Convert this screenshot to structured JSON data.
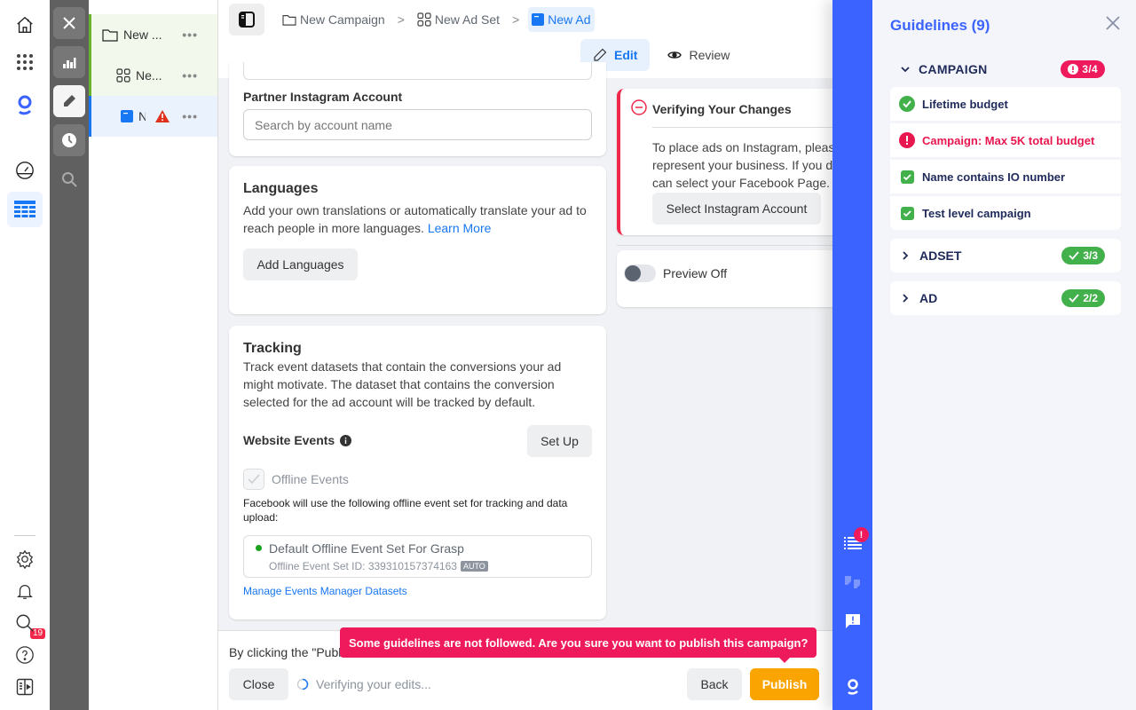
{
  "rail": {
    "top_icons": [
      "home-icon",
      "apps-grid-icon",
      "grasp-logo-icon",
      "dashboard-gauge-icon",
      "table-icon"
    ],
    "bottom_icons": [
      "settings-icon",
      "notifications-icon",
      "search-icon",
      "help-icon",
      "collapse-panel-icon"
    ],
    "notification_count": "19"
  },
  "tools": [
    "close-icon",
    "analytics-icon",
    "edit-icon",
    "history-icon",
    "search-analytics-icon"
  ],
  "tree": {
    "items": [
      {
        "label": "New ...",
        "icon": "folder-icon",
        "level": "campaign"
      },
      {
        "label": "Ne...",
        "icon": "adset-grid-icon",
        "level": "adset"
      },
      {
        "label": "N",
        "icon": "ad-icon",
        "level": "ad",
        "warning": true
      }
    ],
    "more_label": "•••"
  },
  "breadcrumb": {
    "items": [
      {
        "label": "New Campaign",
        "icon": "folder-icon"
      },
      {
        "label": "New Ad Set",
        "icon": "adset-grid-icon"
      },
      {
        "label": "New Ad",
        "icon": "ad-icon",
        "current": true
      }
    ],
    "separator": ">"
  },
  "mode_tabs": [
    {
      "label": "Edit",
      "icon": "pencil-icon",
      "active": true
    },
    {
      "label": "Review",
      "icon": "eye-icon",
      "active": false
    }
  ],
  "partner_instagram": {
    "label": "Partner Instagram Account",
    "placeholder": "Search by account name",
    "value": ""
  },
  "languages": {
    "title": "Languages",
    "description": "Add your own translations or automatically translate your ad to reach people in more languages.",
    "learn_more": "Learn More",
    "button": "Add Languages"
  },
  "tracking": {
    "title": "Tracking",
    "description": "Track event datasets that contain the conversions your ad might motivate. The dataset that contains the conversion selected for the ad account will be tracked by default.",
    "website_events_label": "Website Events",
    "setup_button": "Set Up",
    "offline_events_label": "Offline Events",
    "offline_events_checked": true,
    "offline_note": "Facebook will use the following offline event set for tracking and data upload:",
    "event_set_name": "Default Offline Event Set For Grasp",
    "event_set_id_text": "Offline Event Set ID: 339310157374163",
    "auto_badge": "AUTO",
    "manage_link": "Manage Events Manager Datasets"
  },
  "verify": {
    "title": "Verifying Your Changes",
    "body_lines": [
      "To place ads on Instagram, pleas",
      "represent your business. If you d",
      "can select your Facebook Page. ("
    ],
    "button": "Select Instagram Account"
  },
  "preview": {
    "label": "Preview Off",
    "on": false
  },
  "footer": {
    "terms_text": "By clicking the \"Publ",
    "tooltip": "Some guidelines are not followed. Are you sure you want to publish this campaign?",
    "close": "Close",
    "status": "Verifying your edits...",
    "back": "Back",
    "publish": "Publish"
  },
  "blue_strip": {
    "icons": [
      "guidelines-list-icon",
      "quotes-icon",
      "feedback-icon",
      "grasp-logo-icon"
    ],
    "alert_badge": "!"
  },
  "guidelines": {
    "title": "Guidelines (9)",
    "sections": [
      {
        "name": "CAMPAIGN",
        "expanded": true,
        "status": "fail",
        "count": "3/4",
        "items": [
          {
            "label": "Lifetime budget",
            "status": "pass"
          },
          {
            "label": "Campaign: Max 5K total budget",
            "status": "fail"
          },
          {
            "label": "Name contains IO number",
            "status": "pass"
          },
          {
            "label": "Test level campaign",
            "status": "pass"
          }
        ]
      },
      {
        "name": "ADSET",
        "expanded": false,
        "status": "pass",
        "count": "3/3"
      },
      {
        "name": "AD",
        "expanded": false,
        "status": "pass",
        "count": "2/2"
      }
    ]
  },
  "colors": {
    "accent_blue": "#1877f2",
    "grasp_blue": "#3b63ff",
    "fail_red": "#ef1a5c",
    "pass_green": "#43b14b",
    "publish_orange": "#f9a400"
  }
}
